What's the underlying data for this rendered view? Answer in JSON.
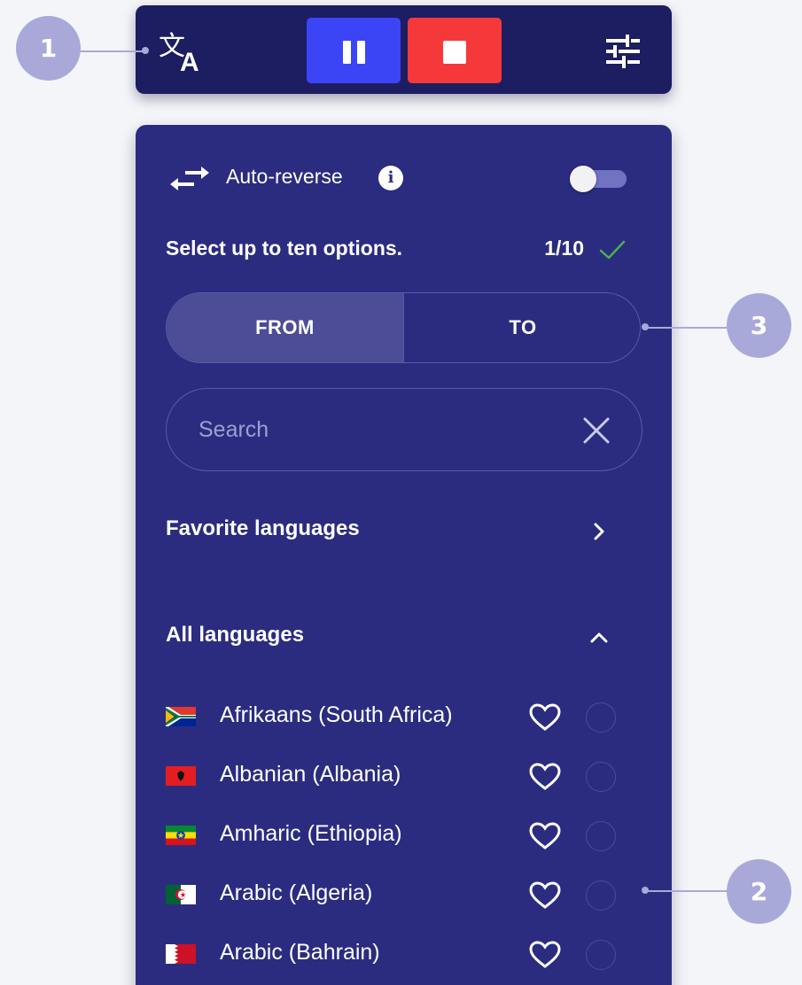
{
  "toolbar": {
    "translate_icon": "translate-icon",
    "pause_icon": "pause-icon",
    "stop_icon": "stop-icon",
    "settings_icon": "sliders-icon",
    "colors": {
      "background": "#1d1d62",
      "pause": "#3c45f6",
      "stop": "#f5393a"
    }
  },
  "panel": {
    "background": "#2b2c80",
    "auto_reverse": {
      "label": "Auto-reverse",
      "info_glyph": "i",
      "enabled": false
    },
    "selection": {
      "hint": "Select up to ten options.",
      "count": "1/10",
      "check_color": "#4caf50"
    },
    "direction_tabs": [
      {
        "label": "FROM",
        "active": true
      },
      {
        "label": "TO",
        "active": false
      }
    ],
    "search": {
      "placeholder": "Search",
      "value": ""
    },
    "favorite_section": {
      "title": "Favorite languages",
      "expanded": false
    },
    "all_section": {
      "title": "All languages",
      "expanded": true
    },
    "languages": [
      {
        "name": "Afrikaans (South Africa)",
        "flag": "za",
        "favorite": false,
        "selected": false
      },
      {
        "name": "Albanian (Albania)",
        "flag": "al",
        "favorite": false,
        "selected": false
      },
      {
        "name": "Amharic (Ethiopia)",
        "flag": "et",
        "favorite": false,
        "selected": false
      },
      {
        "name": "Arabic (Algeria)",
        "flag": "dz",
        "favorite": false,
        "selected": false
      },
      {
        "name": "Arabic (Bahrain)",
        "flag": "bh",
        "favorite": false,
        "selected": false
      }
    ]
  },
  "callouts": [
    {
      "number": "1",
      "color": "#a9a9d9"
    },
    {
      "number": "2",
      "color": "#a9a9d9"
    },
    {
      "number": "3",
      "color": "#a9a9d9"
    }
  ]
}
